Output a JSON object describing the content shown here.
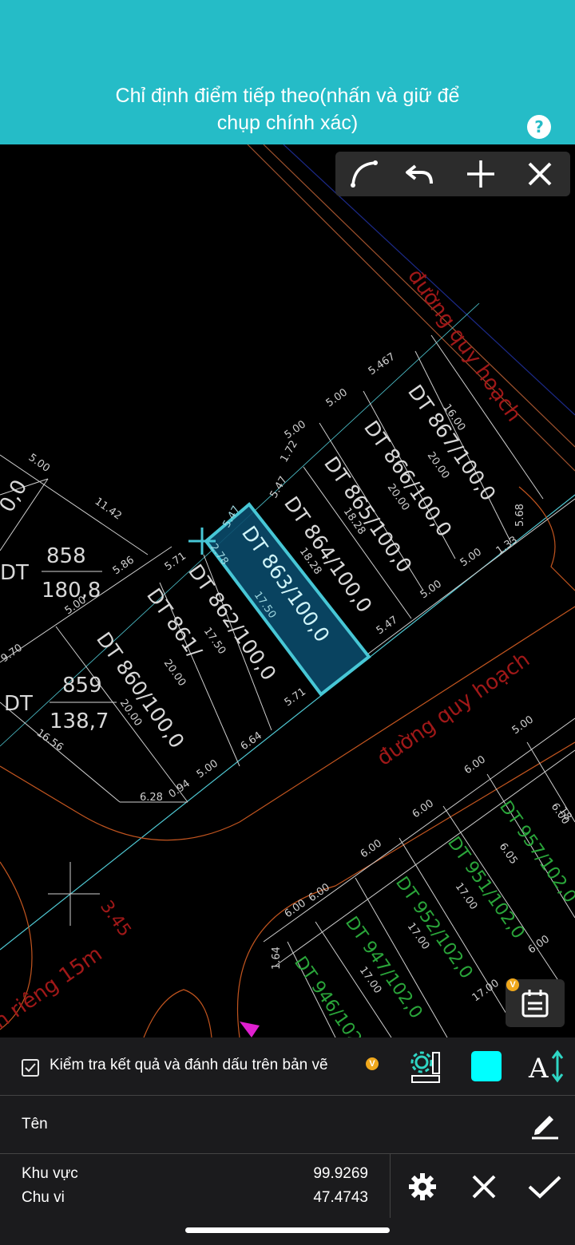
{
  "header": {
    "title_line1": "Chỉ định điểm tiếp theo(nhấn và giữ để",
    "title_line2": "chụp chính xác)",
    "help_icon": "question-circle-icon"
  },
  "toolbar": {
    "arc_icon": "arc-icon",
    "undo_icon": "undo-icon",
    "add_icon": "plus-icon",
    "close_icon": "close-icon"
  },
  "canvas": {
    "highlight_color": "#25bcc7",
    "badge_label": "V",
    "calendar_icon": "calendar-icon",
    "lots": [
      {
        "label": "DT 863/100,0"
      },
      {
        "label": "DT 864/100,0"
      },
      {
        "label": "DT 865/100,0"
      },
      {
        "label": "DT 866/100,0"
      },
      {
        "label": "DT 867/100,0"
      },
      {
        "label": "DT 862/100,0"
      },
      {
        "label": "DT 861/"
      },
      {
        "label": "DT 860/100,0"
      }
    ],
    "parcel_858": {
      "prefix": "DT",
      "num": "858",
      "area": "180,8"
    },
    "parcel_859": {
      "prefix": "DT",
      "num": "859",
      "area": "138,7"
    },
    "road_labels": [
      "đường quy hoạch",
      "đường quy hoạch",
      "h riêng 15m"
    ],
    "dims": [
      "5.467",
      "5.00",
      "5.00",
      "1.72",
      "5.47",
      "5.47",
      "5.47",
      "5.71",
      "5.71",
      "5.86",
      "5.00",
      "11.42",
      "5.00",
      "9.70",
      "16.56",
      "6.28",
      "0.94",
      "5.00",
      "6.64",
      "5.00",
      "5.00",
      "1.33",
      "5.68",
      "16.00",
      "20.00",
      "20.00",
      "18.28",
      "18.28",
      "17.50",
      "17.50",
      "20.00",
      "20.00",
      "2.78",
      "5.00",
      "6.00",
      "6.00",
      "6.00",
      "6.00",
      "6.00",
      "6.00",
      "1.64",
      "6.05",
      "17.00",
      "17.00",
      "17.00",
      "17.00",
      "6.00",
      "3.45"
    ],
    "lots_right": [
      {
        "label": "DT 957/102,0"
      },
      {
        "label": "DT 951/102,0"
      },
      {
        "label": "DT 952/102,0"
      },
      {
        "label": "DT 947/102,0"
      },
      {
        "label": "DT 946/102,0"
      }
    ],
    "partial_labels": [
      "0,0",
      "18"
    ]
  },
  "panel": {
    "check_label": "Kiểm tra kết quả và đánh dấu trên bản vẽ",
    "badge": "V",
    "swatch_color": "#00ffff",
    "name_label": "Tên",
    "area_label": "Khu vực",
    "area_value": "99.9269",
    "perimeter_label": "Chu vi",
    "perimeter_value": "47.4743",
    "settings_icon": "gear-icon",
    "cancel_icon": "close-icon",
    "confirm_icon": "check-icon",
    "edit_icon": "pencil-icon",
    "measure_icon": "ruler-gear-icon",
    "text_size_icon": "text-size-icon"
  }
}
